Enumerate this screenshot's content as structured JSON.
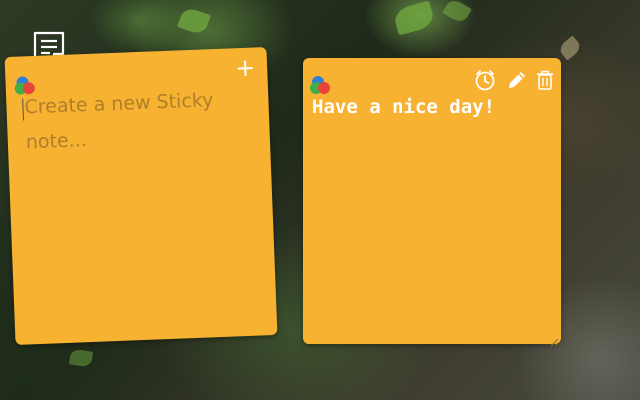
{
  "notes": [
    {
      "placeholder": "Create a new Sticky note...",
      "actions": {
        "add_label": "+"
      }
    },
    {
      "text": "Have a nice day!",
      "actions": [
        "alarm-clock-icon",
        "pencil-icon",
        "trash-icon"
      ]
    }
  ],
  "colors": {
    "note_background": "#f8b232",
    "note_text": "#ffffff",
    "dot_blue": "#2f7fd8",
    "dot_green": "#3fae49",
    "dot_red": "#e8443a"
  },
  "icons": {
    "app": "sticky-note-icon",
    "color_picker": "color-picker-icon"
  }
}
